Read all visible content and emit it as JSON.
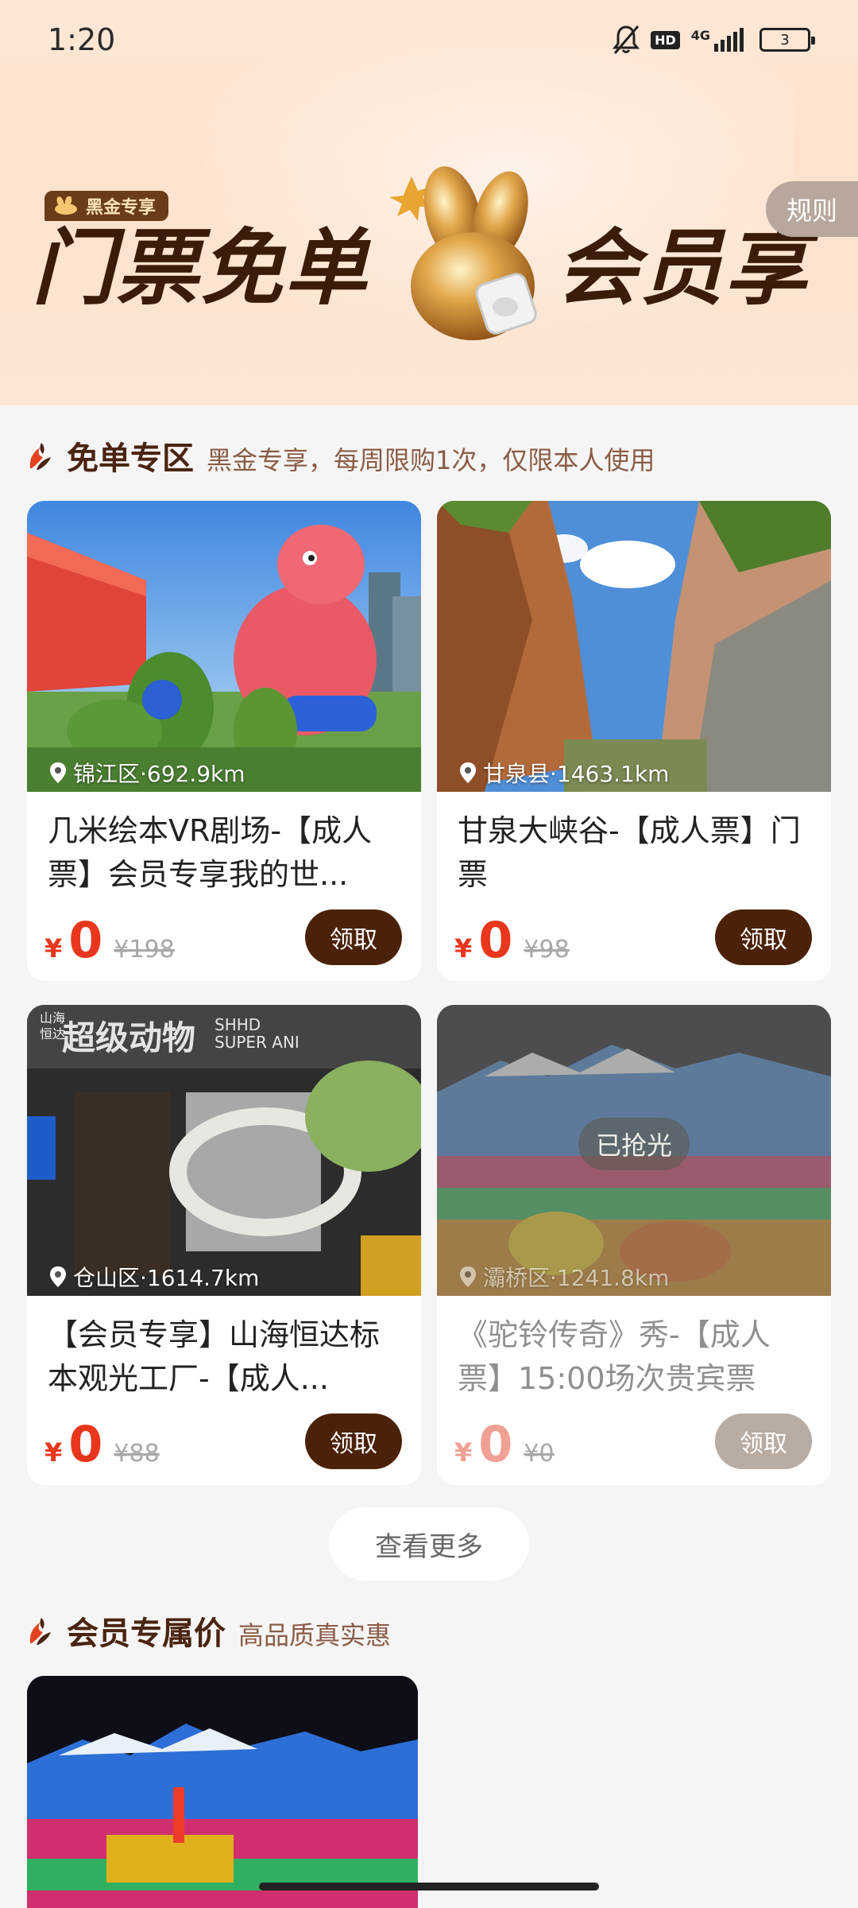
{
  "status_bar": {
    "time": "1:20",
    "hd": "HD",
    "network": "4G",
    "battery": "3"
  },
  "hero": {
    "vip_tag": "黑金专享",
    "title_left": "门票免单",
    "title_right": "会员享",
    "rules_label": "规则"
  },
  "free_zone": {
    "title": "免单专区",
    "subtitle": "黑金专享，每周限购1次，仅限本人使用",
    "cards": [
      {
        "location": "锦江区·692.9km",
        "title": "几米绘本VR剧场-【成人票】会员专享我的世...",
        "yen": "¥",
        "price": "0",
        "original_price": "¥198",
        "button": "领取"
      },
      {
        "location": "甘泉县·1463.1km",
        "title": "甘泉大峡谷-【成人票】门票",
        "yen": "¥",
        "price": "0",
        "original_price": "¥98",
        "button": "领取"
      },
      {
        "location": "仓山区·1614.7km",
        "title": "【会员专享】山海恒达标本观光工厂-【成人...",
        "yen": "¥",
        "price": "0",
        "original_price": "¥88",
        "button": "领取",
        "image_text_1": "超级动物",
        "image_text_2": "SHHD SUPER ANI"
      },
      {
        "location": "灞桥区·1241.8km",
        "title": "《驼铃传奇》秀-【成人票】15:00场次贵宾票",
        "yen": "¥",
        "price": "0",
        "original_price": "¥0",
        "button": "领取",
        "badge": "已抢光"
      }
    ],
    "more_button": "查看更多"
  },
  "member_zone": {
    "title": "会员专属价",
    "subtitle": "高品质真实惠"
  },
  "colors": {
    "accent_brown": "#4b2209",
    "price_red": "#e8371d",
    "hero_bg": "#fde4d0"
  }
}
